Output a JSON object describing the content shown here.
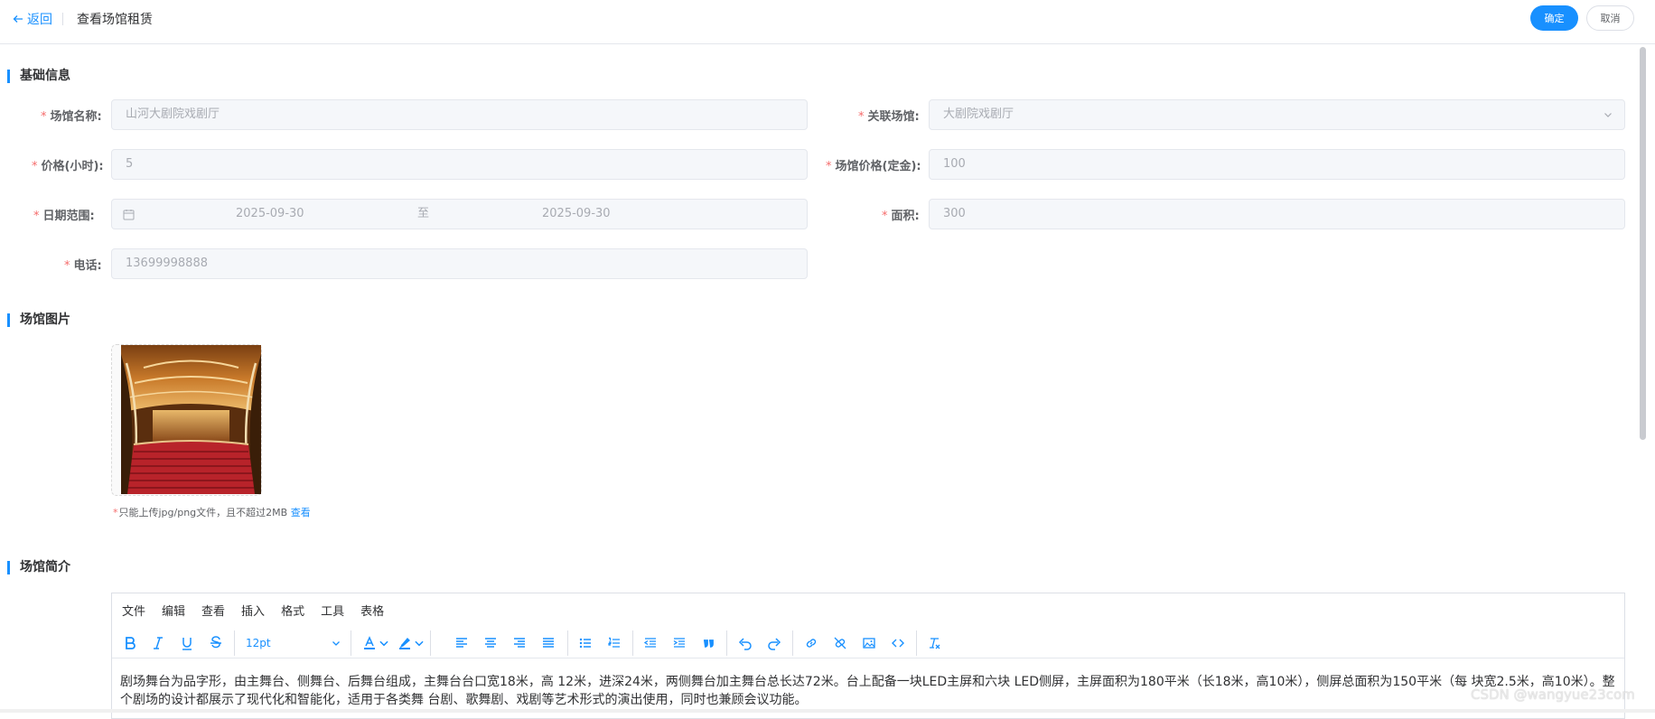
{
  "header": {
    "back_label": "返回",
    "title": "查看场馆租赁",
    "confirm_label": "确定",
    "cancel_label": "取消"
  },
  "sections": {
    "basic": "基础信息",
    "images": "场馆图片",
    "intro": "场馆简介"
  },
  "form": {
    "venue_name": {
      "label": "场馆名称:",
      "value": "山河大剧院戏剧厅"
    },
    "related_venue": {
      "label": "关联场馆:",
      "value": "大剧院戏剧厅"
    },
    "price_hour": {
      "label": "价格(小时):",
      "value": "5"
    },
    "deposit": {
      "label": "场馆价格(定金):",
      "value": "100"
    },
    "date_range": {
      "label": "日期范围:",
      "start": "2025-09-30",
      "separator": "至",
      "end": "2025-09-30"
    },
    "area": {
      "label": "面积:",
      "value": "300"
    },
    "phone": {
      "label": "电话:",
      "value": "13699998888"
    },
    "required_mark": "*"
  },
  "upload": {
    "hint": "只能上传jpg/png文件，且不超过2MB",
    "view_link": "查看"
  },
  "editor": {
    "menu": [
      "文件",
      "编辑",
      "查看",
      "插入",
      "格式",
      "工具",
      "表格"
    ],
    "font_size": "12pt",
    "content": "剧场舞台为品字形，由主舞台、侧舞台、后舞台组成，主舞台台口宽18米，高 12米，进深24米，两侧舞台加主舞台总长达72米。台上配备一块LED主屏和六块 LED侧屏，主屏面积为180平米（长18米，高10米），侧屏总面积为150平米（每 块宽2.5米，高10米）。整个剧场的设计都展示了现代化和智能化，适用于各类舞 台剧、歌舞剧、戏剧等艺术形式的演出使用，同时也兼顾会议功能。"
  },
  "watermark": "CSDN @wangyue23com",
  "colors": {
    "accent": "#1890ff",
    "required": "#f56c6c",
    "disabled_bg": "#f5f7fa"
  }
}
